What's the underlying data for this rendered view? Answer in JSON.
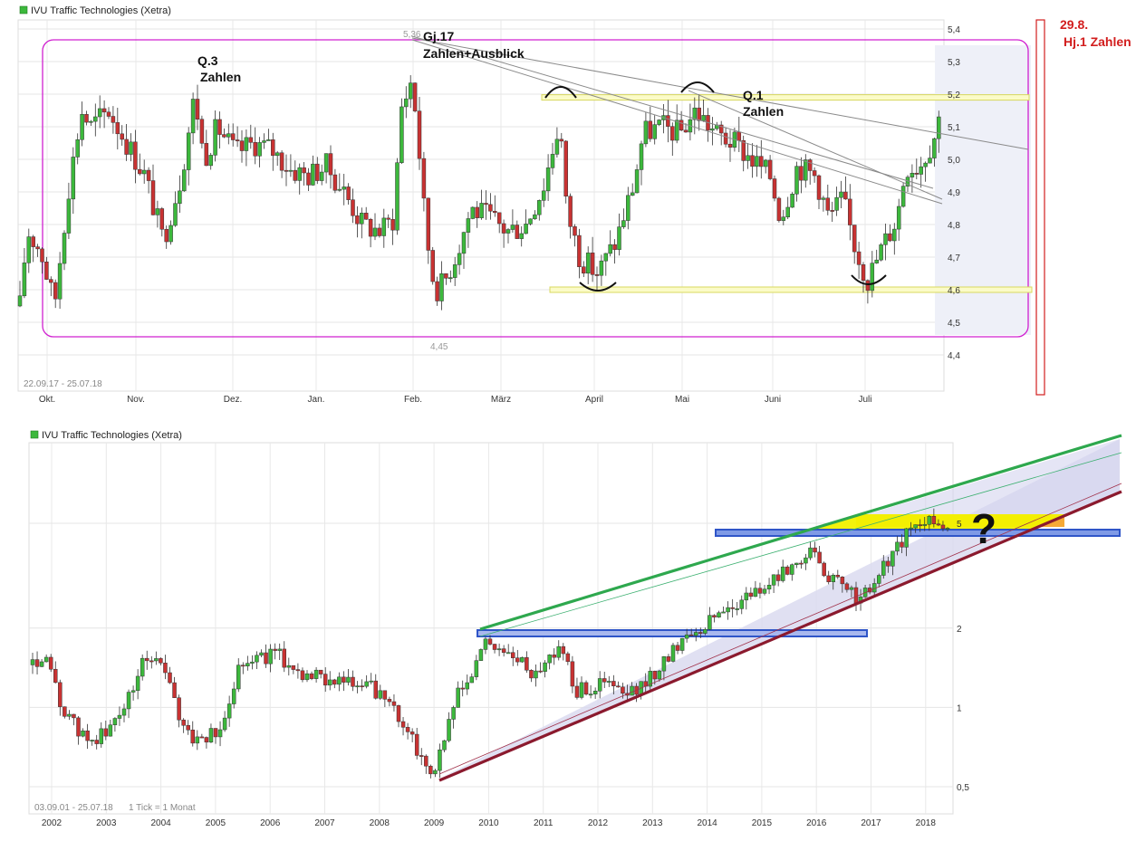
{
  "chart_data": [
    {
      "type": "candlestick",
      "title": "IVU Traffic Technologies (Xetra)",
      "date_range": "22.09.17 - 25.07.18",
      "x_tick_labels": [
        "Okt.",
        "Nov.",
        "Dez.",
        "Jan.",
        "Feb.",
        "März",
        "April",
        "Mai",
        "Juni",
        "Juli"
      ],
      "y_tick_labels": [
        "5,4",
        "5,3",
        "5,2",
        "5,1",
        "5,0",
        "4,9",
        "4,8",
        "4,7",
        "4,6",
        "4,5",
        "4,4"
      ],
      "ylim": [
        4.38,
        5.43
      ],
      "high_label": "5,36",
      "low_label": "4,45",
      "support_level": 4.6,
      "resistance_level": 5.19,
      "annotations": [
        {
          "text": "Q.3",
          "text2": "Zahlen"
        },
        {
          "text": "Gj.17",
          "text2": "Zahlen+Ausblick"
        },
        {
          "text": "Q.1",
          "text2": "Zahlen"
        },
        {
          "text": "29.8.",
          "text2": "Hj.1 Zahlen",
          "color": "#d21e1e"
        }
      ],
      "colors": {
        "up": "#3cb83c",
        "down": "#c83232",
        "range_box": "#d020d0",
        "level_band": "#f0f080",
        "side_fill": "#e6e6f5"
      }
    },
    {
      "type": "candlestick",
      "title": "IVU Traffic Technologies (Xetra)",
      "date_range": "03.09.01 - 25.07.18",
      "tick_note": "1 Tick = 1 Monat",
      "scale": "log",
      "x_tick_labels": [
        "2002",
        "2003",
        "2004",
        "2005",
        "2006",
        "2007",
        "2008",
        "2009",
        "2010",
        "2011",
        "2012",
        "2013",
        "2014",
        "2015",
        "2016",
        "2017",
        "2018"
      ],
      "y_tick_labels": [
        "5",
        "2",
        "1",
        "0,5"
      ],
      "ylim": [
        0.47,
        8.6
      ],
      "annotations": [
        {
          "text": "?"
        }
      ],
      "colors": {
        "up": "#3cb83c",
        "down": "#c83232",
        "channel_top": "#2ea84e",
        "channel_bottom": "#8b1a2e",
        "channel_fill": "#dadaf0",
        "blue_zone": "#2f55c8",
        "yellow_zone": "#f2f200",
        "orange_zone": "#f5a020"
      }
    }
  ]
}
